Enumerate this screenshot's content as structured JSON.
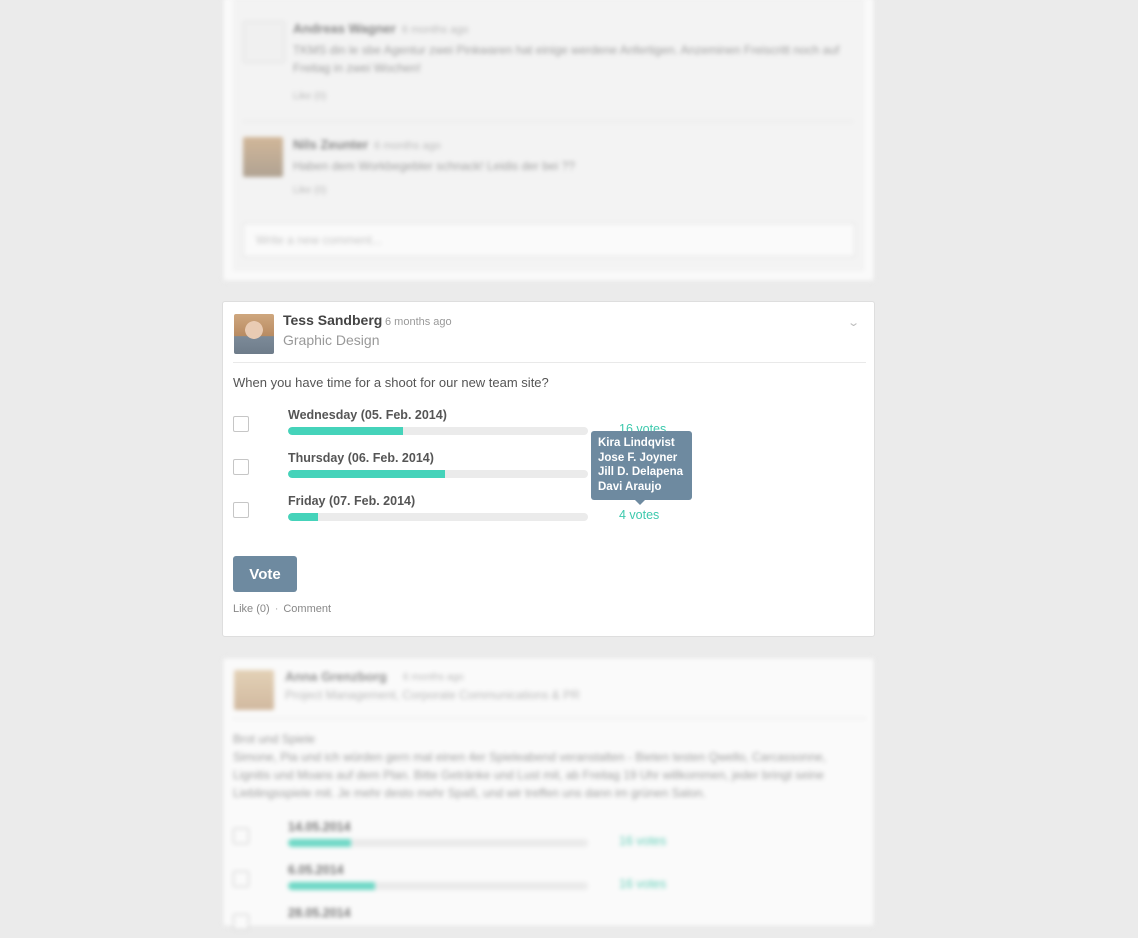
{
  "top_card": {
    "comments": [
      {
        "name": "Andreas Wagner",
        "time": "6 months ago",
        "text": "TKMS din le sbe Agentur zwei Pinkwaren hat einige werdene Anfertigen. Anzeminen Freiscritt noch auf Freitag in zwei Wochen!",
        "like": "Like (0)"
      },
      {
        "name": "Nils Zeunter",
        "time": "6 months ago",
        "text": "Haben dem Workbegebler schnack! Leidis der bei ??",
        "like": "Like (0)"
      }
    ],
    "new_comment_placeholder": "Write a new comment..."
  },
  "poll_card": {
    "author": "Tess Sandberg",
    "time": "6 months ago",
    "group": "Graphic Design",
    "question": "When you have time for a shoot for our new team site?",
    "options": [
      {
        "label": "Wednesday (05. Feb. 2014)",
        "fill": 0.383,
        "votes": "16 votes"
      },
      {
        "label": "Thursday (06. Feb. 2014)",
        "fill": 0.523,
        "votes": ""
      },
      {
        "label": "Friday (07. Feb. 2014)",
        "fill": 0.1,
        "votes": "4 votes"
      }
    ],
    "tooltip_voters": [
      "Kira Lindqvist",
      "Jose F. Joyner",
      "Jill D. Delapena",
      "Davi Araujo"
    ],
    "vote_button": "Vote",
    "like_label": "Like (0)",
    "separator": "·",
    "comment_label": "Comment",
    "colors": {
      "accent": "#45d3ba",
      "button": "#6e8aa0"
    }
  },
  "bottom_card": {
    "author": "Anna Grenzborg",
    "time": "6 months ago",
    "group": "Project Management, Corporate Communications & PR",
    "title": "Brot und Spiele",
    "text": "Simone, Pia und ich würden gern mal einen 4er Spieleabend veranstalten - Bieten testen Qwello, Carcassonne, Lignitis und Moans auf dem Plan. Bitte Getränke und Lust mit, ab Freitag 19 Uhr willkommen, jeder bringt seine Lieblingsspiele mit. Je mehr desto mehr Spaß, und wir treffen uns dann im grünen Salon.",
    "options": [
      {
        "label": "14.05.2014",
        "fill": 0.21,
        "votes": "16 votes"
      },
      {
        "label": "6.05.2014",
        "fill": 0.29,
        "votes": "16 votes"
      },
      {
        "label": "28.05.2014",
        "fill": 0.1,
        "votes": ""
      }
    ]
  }
}
